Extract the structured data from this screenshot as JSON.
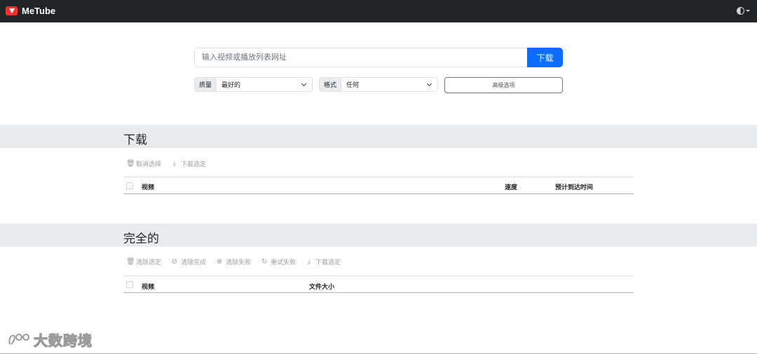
{
  "app": {
    "title": "MeTube"
  },
  "form": {
    "url_placeholder": "输入视频或播放列表网址",
    "download_button": "下载",
    "quality_label": "质量",
    "quality_value": "最好的",
    "format_label": "格式",
    "format_value": "任何",
    "advanced_button": "高级选项"
  },
  "downloads": {
    "title": "下载",
    "actions": [
      {
        "icon": "trash-icon",
        "label": "取消选择"
      },
      {
        "icon": "download-icon",
        "label": "下载选定"
      }
    ],
    "columns": {
      "video": "视频",
      "speed": "速度",
      "eta": "预计到达时间"
    }
  },
  "completed": {
    "title": "完全的",
    "actions": [
      {
        "icon": "trash-icon",
        "label": "清除选定"
      },
      {
        "icon": "check-circle-icon",
        "label": "清除完成"
      },
      {
        "icon": "x-circle-icon",
        "label": "清除失败"
      },
      {
        "icon": "retry-icon",
        "label": "重试失败"
      },
      {
        "icon": "download-icon",
        "label": "下载选定"
      }
    ],
    "columns": {
      "video": "视频",
      "size": "文件大小"
    }
  },
  "watermark": {
    "text": "大数跨境"
  }
}
